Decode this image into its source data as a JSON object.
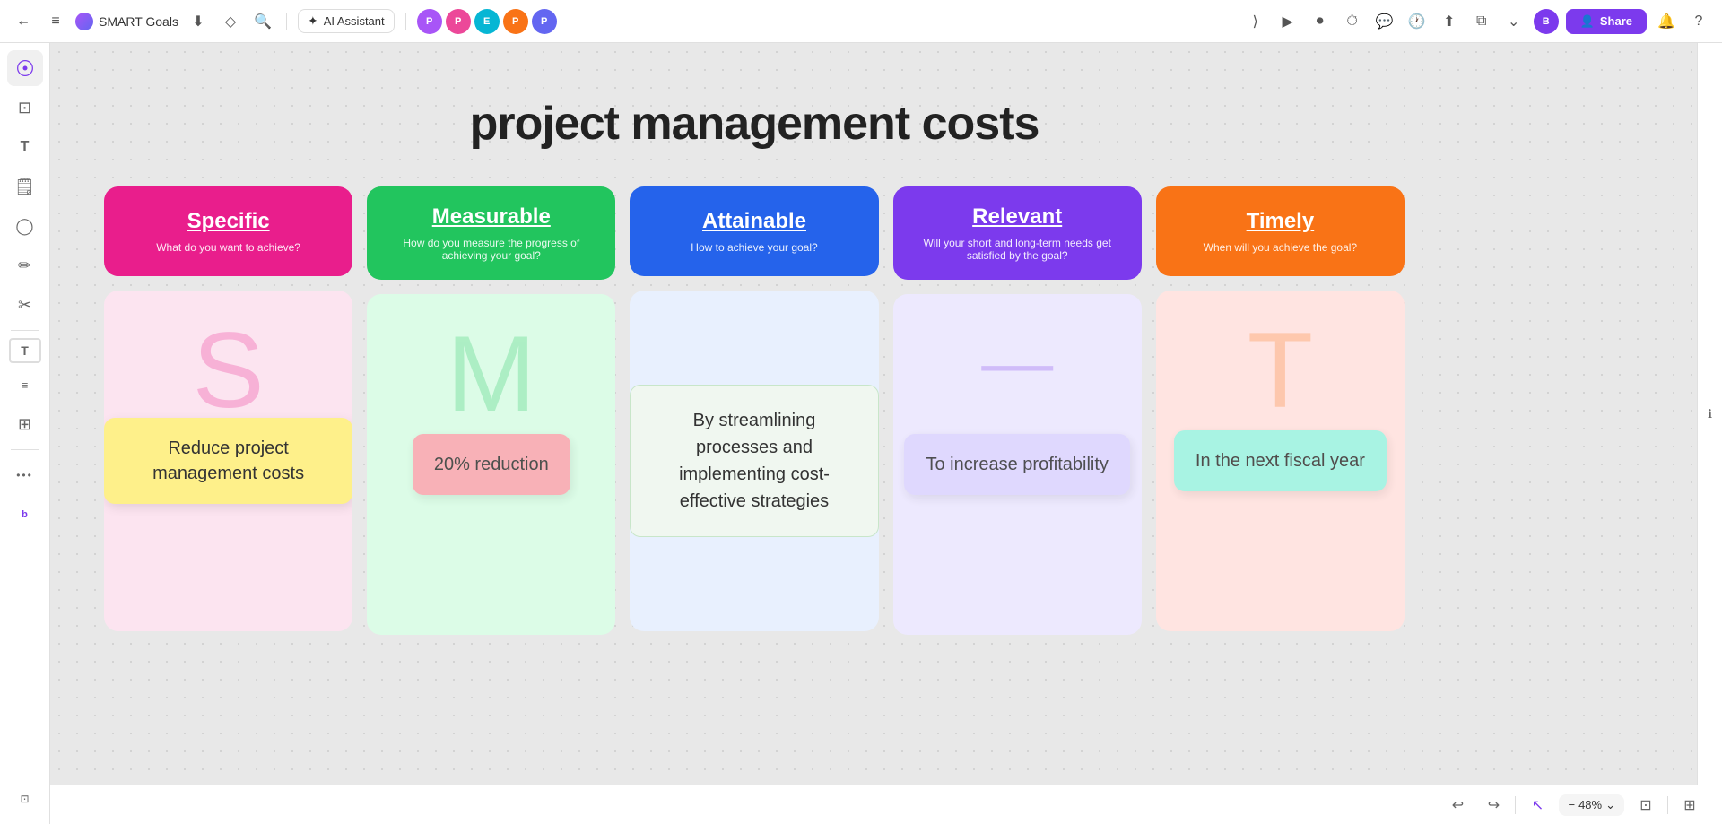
{
  "app": {
    "title": "SMART Goals",
    "logo_alt": "logo"
  },
  "topbar": {
    "back_icon": "←",
    "menu_icon": "≡",
    "download_icon": "⬇",
    "tag_icon": "🏷",
    "search_icon": "🔍",
    "ai_label": "AI Assistant",
    "collab": [
      {
        "color": "#a855f7",
        "initials": "P"
      },
      {
        "color": "#ec4899",
        "initials": "P"
      },
      {
        "color": "#06b6d4",
        "initials": "E"
      },
      {
        "color": "#f97316",
        "initials": "P"
      },
      {
        "color": "#6366f1",
        "initials": "P"
      }
    ],
    "expand_icon": "⟩",
    "share_label": "Share",
    "bell_icon": "🔔",
    "help_icon": "?"
  },
  "canvas": {
    "page_title": "project management costs",
    "columns": [
      {
        "id": "specific",
        "header_label": "Specific",
        "header_sublabel": "What do you want to achieve?",
        "content_note": "Reduce project management costs",
        "note_style": "yellow",
        "panel_style": "specific"
      },
      {
        "id": "measurable",
        "header_label": "Measurable",
        "header_sublabel": "How do you measure the progress of achieving your goal?",
        "content_note": "20% reduction",
        "note_style": "pink",
        "panel_style": "measurable"
      },
      {
        "id": "attainable",
        "header_label": "Attainable",
        "header_sublabel": "How to achieve your goal?",
        "content_note": "By streamlining processes and implementing cost-effective strategies",
        "note_style": "teal",
        "panel_style": "attainable"
      },
      {
        "id": "relevant",
        "header_label": "Relevant",
        "header_sublabel": "Will your short and long-term needs get satisfied by the goal?",
        "content_note": "To increase profitability",
        "note_style": "lavender",
        "panel_style": "relevant"
      },
      {
        "id": "timely",
        "header_label": "Timely",
        "header_sublabel": "When will you achieve the goal?",
        "content_note": "In the next fiscal year",
        "note_style": "teal",
        "panel_style": "timely"
      }
    ]
  },
  "bottombar": {
    "undo_icon": "↩",
    "redo_icon": "↪",
    "zoom_label": "48%",
    "zoom_in_icon": "+",
    "zoom_fit_icon": "⊡",
    "grid_icon": "⊞"
  },
  "sidebar": {
    "items": [
      {
        "icon": "🎨",
        "label": "paint-icon"
      },
      {
        "icon": "⊡",
        "label": "frame-icon"
      },
      {
        "icon": "T",
        "label": "text-icon"
      },
      {
        "icon": "🗒",
        "label": "note-icon"
      },
      {
        "icon": "◯",
        "label": "shape-icon"
      },
      {
        "icon": "✏",
        "label": "pen-icon"
      },
      {
        "icon": "✂",
        "label": "scissors-icon"
      },
      {
        "icon": "T",
        "label": "text2-icon"
      },
      {
        "icon": "≡",
        "label": "list-icon"
      },
      {
        "icon": "⊞",
        "label": "table-icon"
      },
      {
        "icon": "•••",
        "label": "more-icon"
      },
      {
        "icon": "🎭",
        "label": "template-icon"
      }
    ]
  }
}
